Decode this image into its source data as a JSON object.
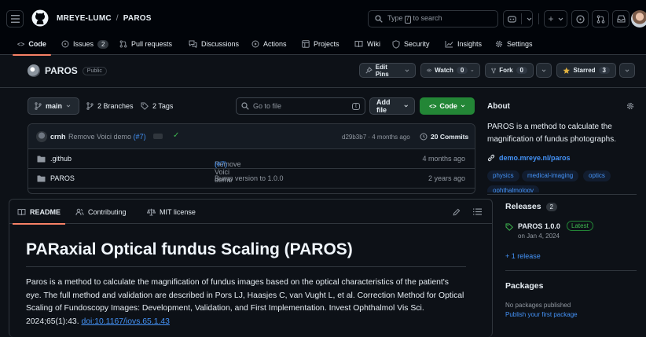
{
  "header": {
    "owner": "MREYE-LUMC",
    "separator": "/",
    "repo": "PAROS",
    "search_prefix": "Type",
    "search_key": "/",
    "search_suffix": "to search",
    "plus": "+"
  },
  "tabs": [
    {
      "label": "Code"
    },
    {
      "label": "Issues",
      "count": "2"
    },
    {
      "label": "Pull requests"
    },
    {
      "label": "Discussions"
    },
    {
      "label": "Actions"
    },
    {
      "label": "Projects"
    },
    {
      "label": "Wiki"
    },
    {
      "label": "Security"
    },
    {
      "label": "Insights"
    },
    {
      "label": "Settings"
    }
  ],
  "repo_header": {
    "name": "PAROS",
    "visibility": "Public",
    "edit_pins": "Edit Pins",
    "watch": "Watch",
    "watch_count": "0",
    "fork": "Fork",
    "fork_count": "0",
    "starred": "Starred",
    "star_count": "3"
  },
  "file_controls": {
    "branch": "main",
    "branches": "2 Branches",
    "tags": "2 Tags",
    "goto_placeholder": "Go to file",
    "goto_key": "t",
    "add_file": "Add file",
    "code": "Code"
  },
  "latest_commit": {
    "author": "crnh",
    "message": "Remove Voici demo",
    "pr": "(#7)",
    "hash_time": "d29b3b7 · 4 months ago",
    "commits": "20 Commits"
  },
  "files": [
    {
      "name": ".github",
      "message": "Remove Voici demo",
      "pr": "(#7)",
      "time": "4 months ago"
    },
    {
      "name": "PAROS",
      "message": "Bump version to 1.0.0",
      "pr": "",
      "time": "2 years ago"
    }
  ],
  "about": {
    "title": "About",
    "description": "PAROS is a method to calculate the magnification of fundus photographs.",
    "website": "demo.mreye.nl/paros",
    "topics": [
      "physics",
      "medical-imaging",
      "optics",
      "ophthalmology"
    ]
  },
  "releases": {
    "title": "Releases",
    "count": "2",
    "latest_name": "PAROS 1.0.0",
    "latest_badge": "Latest",
    "date": "on Jan 4, 2024",
    "more": "+ 1 release"
  },
  "packages": {
    "title": "Packages",
    "none": "No packages published",
    "publish": "Publish your first package"
  },
  "readme": {
    "tabs": [
      "README",
      "Contributing",
      "MIT license"
    ],
    "title": "PARaxial Optical fundus Scaling (PAROS)",
    "body": "Paros is a method to calculate the magnification of fundus images based on the optical characteristics of the patient's eye. The full method and validation are described in Pors LJ, Haasjes C, van Vught L, et al. Correction Method for Optical Scaling of Fundoscopy Images: Development, Validation, and First Implementation. Invest Ophthalmol Vis Sci. 2024;65(1):43.",
    "doi": "doi:10.1167/iovs.65.1.43"
  },
  "colors": {
    "accent": "#f78166",
    "link": "#4493f8",
    "success": "#238636",
    "latest": "#3fb950",
    "star": "#e3b341"
  }
}
